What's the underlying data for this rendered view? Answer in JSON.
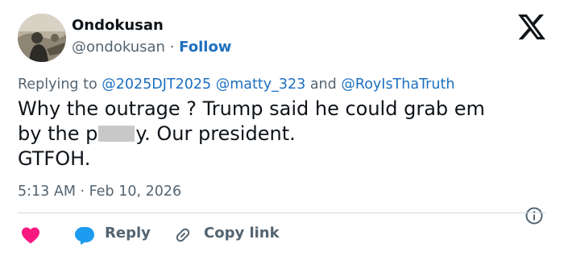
{
  "author": {
    "name": "Ondokusan",
    "handle": "@ondokusan",
    "separator": "·",
    "follow_label": "Follow"
  },
  "logo_icon": "x-logo-icon",
  "reply_context": {
    "prefix": "Replying to",
    "mention_1": "@2025DJT2025",
    "mention_2": "@matty_323",
    "conjunction": "and",
    "mention_3": "@RoyIsThaTruth"
  },
  "tweet": {
    "line1": "Why the outrage ? Trump said he could grab em",
    "line2_start": "by the p",
    "line2_end": "y. Our president.",
    "line3": "GTFOH."
  },
  "meta": {
    "time": "5:13 AM",
    "separator": "·",
    "date": "Feb 10, 2026"
  },
  "actions": {
    "reply_label": "Reply",
    "copy_link_label": "Copy link"
  },
  "colors": {
    "link": "#1d6fbf",
    "muted": "#536471",
    "text": "#0f1419",
    "heart": "#f91880",
    "reply_bubble": "#1d9bf0",
    "divider": "#cfd9de"
  }
}
